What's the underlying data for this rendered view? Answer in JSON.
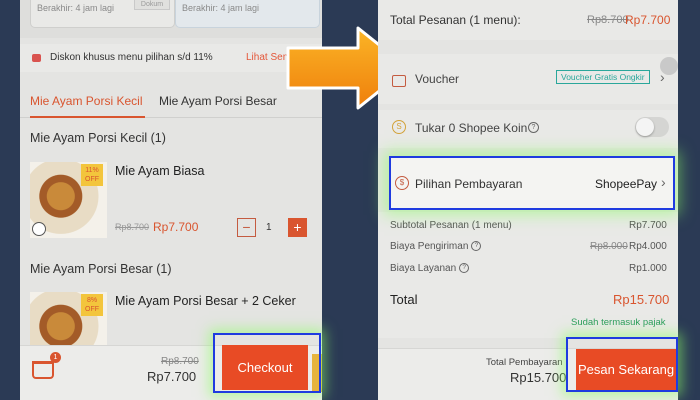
{
  "left": {
    "vouchers": [
      {
        "expiry": "Berakhir: 4 jam lagi",
        "stub": "Dokum"
      },
      {
        "expiry": "Berakhir: 4 jam lagi"
      }
    ],
    "discount": {
      "text": "Diskon khusus menu pilihan s/d 11%",
      "link": "Lihat Sem"
    },
    "tabs": [
      "Mie Ayam Porsi Kecil",
      "Mie Ayam Porsi Besar"
    ],
    "sections": [
      {
        "title": "Mie Ayam Porsi Kecil (1)",
        "item": {
          "name": "Mie Ayam Biasa",
          "badge": "11% OFF",
          "price_old": "Rp8.700",
          "price_new": "Rp7.700",
          "qty": "1"
        }
      },
      {
        "title": "Mie Ayam Porsi Besar (1)",
        "item": {
          "name": "Mie Ayam Porsi Besar + 2 Ceker",
          "badge": "8% OFF"
        }
      }
    ],
    "bottom": {
      "basket_count": "1",
      "price_old": "Rp8.700",
      "price_new": "Rp7.700",
      "checkout": "Checkout"
    }
  },
  "right": {
    "total_order": {
      "label": "Total Pesanan (1 menu):",
      "old": "Rp8.700",
      "new": "Rp7.700"
    },
    "voucher": {
      "label": "Voucher",
      "badge": "Voucher Gratis Ongkir"
    },
    "koin": {
      "label": "Tukar 0 Shopee Koin",
      "enabled": false
    },
    "payment": {
      "label": "Pilihan Pembayaran",
      "value": "ShopeePay"
    },
    "summary": [
      {
        "label": "Subtotal Pesanan (1 menu)",
        "value": "Rp7.700"
      },
      {
        "label": "Biaya Pengiriman",
        "old": "Rp8.000",
        "value": "Rp4.000"
      },
      {
        "label": "Biaya Layanan",
        "value": "Rp1.000"
      }
    ],
    "total": {
      "label": "Total",
      "value": "Rp15.700",
      "note": "Sudah termasuk pajak"
    },
    "bottom": {
      "label": "Total Pembayaran",
      "value": "Rp15.700",
      "order": "Pesan Sekarang"
    }
  },
  "colors": {
    "accent": "#e84b25",
    "highlight": "#1f3be0",
    "arrow": "#f39a12",
    "background": "#2b3a55"
  }
}
